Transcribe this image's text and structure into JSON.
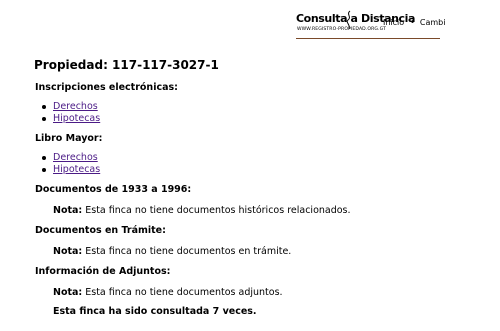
{
  "header": {
    "logo": {
      "title": "Consulta a Distancia",
      "subtitle": "WWW.REGISTRO-PROPIEDAD.ORG.GT"
    },
    "nav": [
      {
        "label": "Inicio"
      },
      {
        "label": "Cambi"
      }
    ],
    "nav_separator": "•"
  },
  "page": {
    "title": "Propiedad: 117-117-3027-1"
  },
  "inscripciones": {
    "heading": "Inscripciones electrónicas:",
    "links": [
      {
        "label": "Derechos"
      },
      {
        "label": "Hipotecas"
      }
    ]
  },
  "libro_mayor": {
    "heading": "Libro Mayor:",
    "links": [
      {
        "label": "Derechos"
      },
      {
        "label": "Hipotecas"
      }
    ]
  },
  "documentos_1933": {
    "heading": "Documentos de 1933 a 1996:",
    "note_label": "Nota:",
    "note_text": " Esta finca no tiene documentos históricos relacionados."
  },
  "documentos_tramite": {
    "heading": "Documentos en Trámite:",
    "note_label": "Nota:",
    "note_text": " Esta finca no tiene documentos en trámite."
  },
  "adjuntos": {
    "heading": "Información de Adjuntos:",
    "note_label": "Nota:",
    "note_text": " Esta finca no tiene documentos adjuntos."
  },
  "consultation": {
    "text": "Esta finca ha sido consultada 7 veces."
  },
  "colors": {
    "link": "#4b1b86",
    "header_rule": "#7a4a2a"
  }
}
